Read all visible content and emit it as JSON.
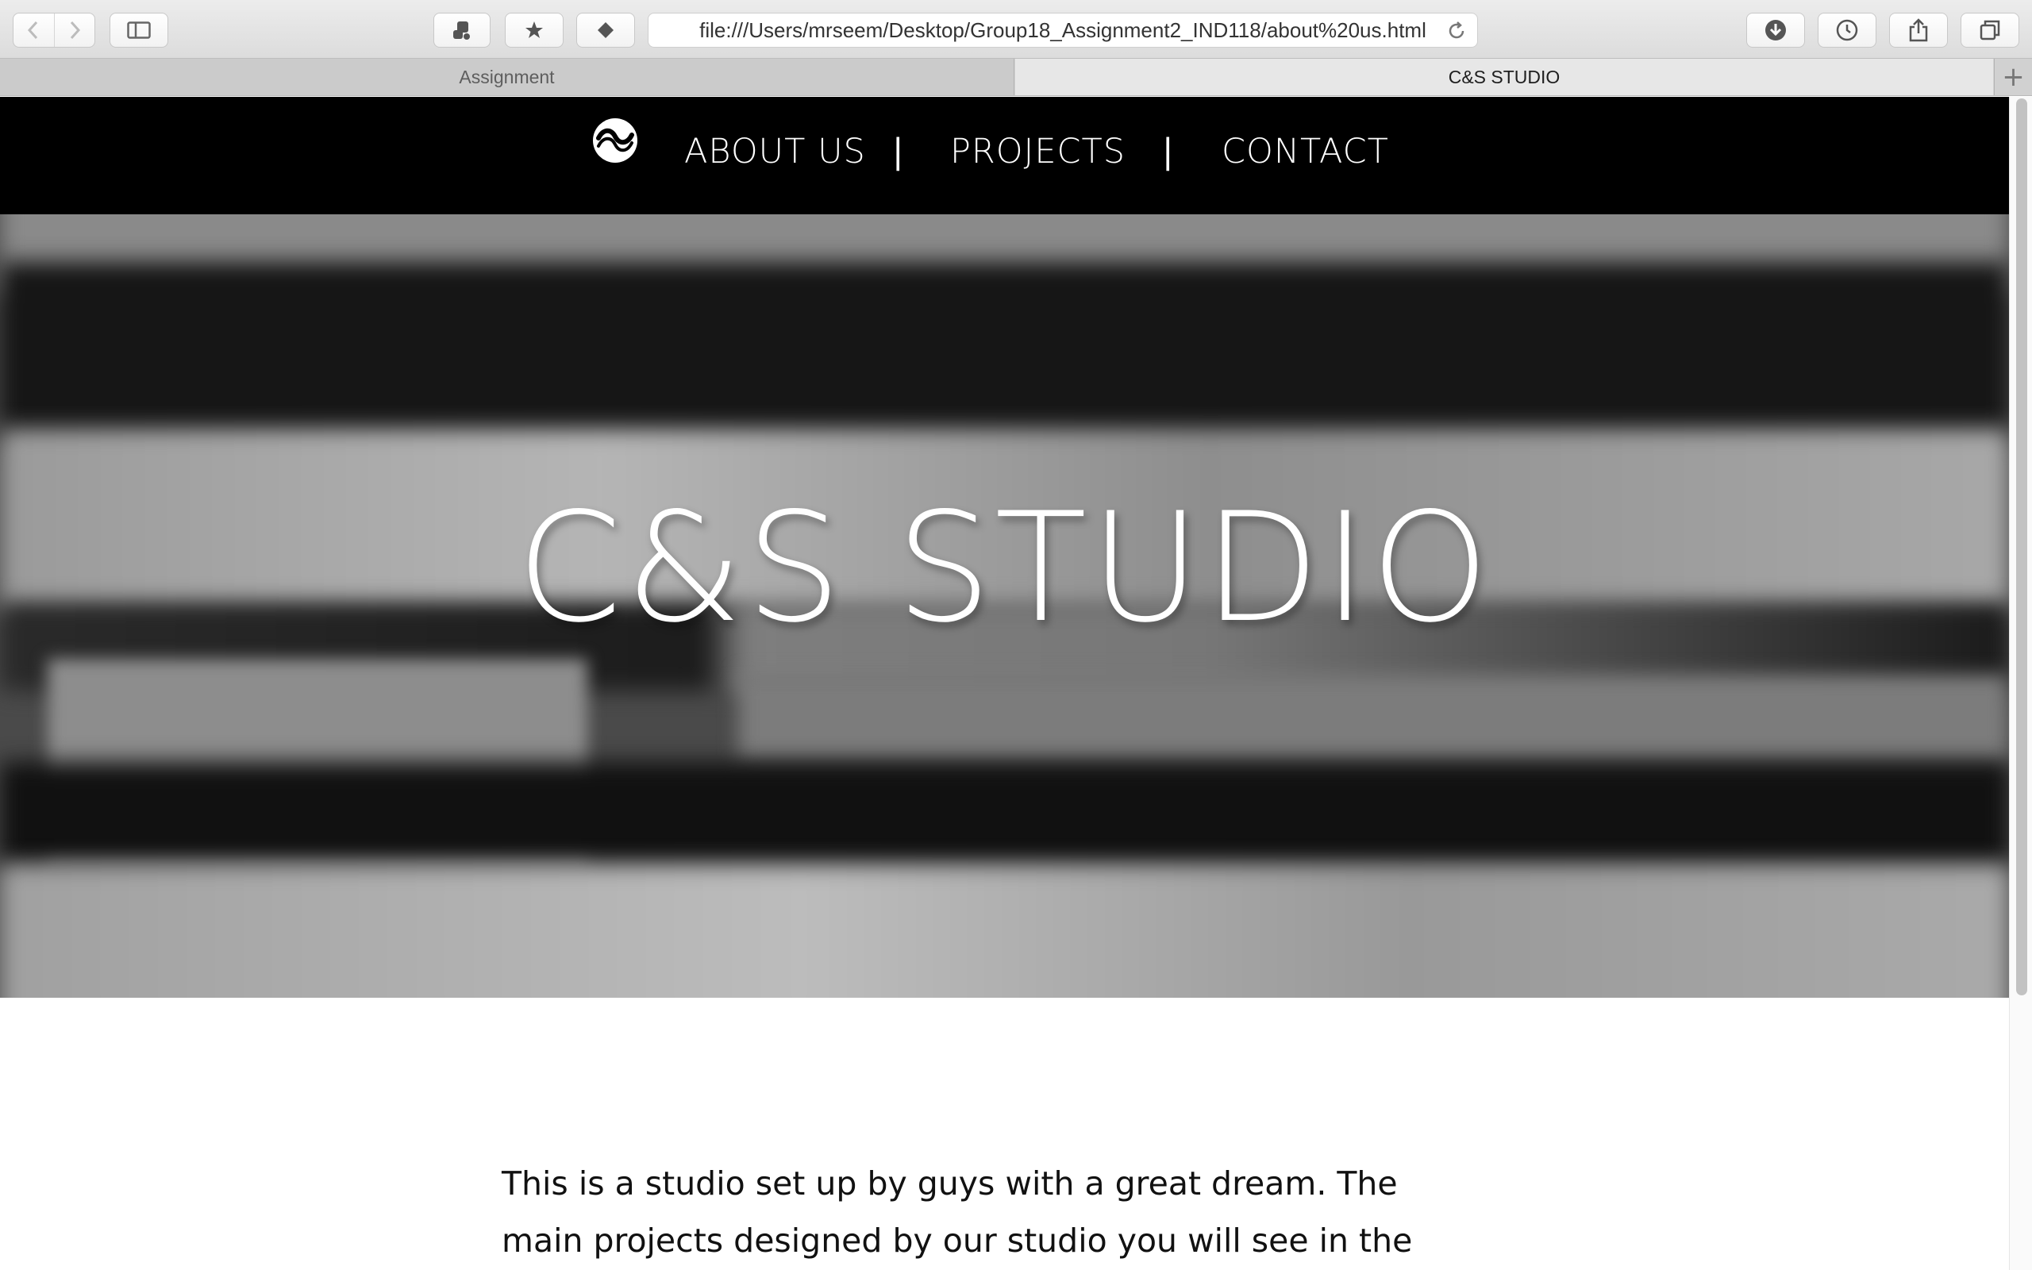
{
  "browser": {
    "url": "file:///Users/mrseem/Desktop/Group18_Assignment2_IND118/about%20us.html",
    "tabs": [
      {
        "label": "Assignment",
        "active": false
      },
      {
        "label": "C&S STUDIO",
        "active": true
      }
    ],
    "new_tab_symbol": "+"
  },
  "site": {
    "nav": {
      "items": [
        "ABOUT US",
        "PROJECTS",
        "CONTACT"
      ],
      "separator": "|"
    },
    "hero": {
      "title": "C&S STUDIO"
    },
    "intro": "This is a studio set up by guys with a great dream. The main projects designed by our studio you will see in the following"
  },
  "icons": {
    "toolbar": [
      "back-icon",
      "forward-icon",
      "sidebar-icon",
      "extension-icon",
      "bookmark-star-icon",
      "diamond-icon",
      "reload-icon",
      "download-icon",
      "history-icon",
      "share-icon",
      "tabs-overview-icon"
    ],
    "logo": "cs-studio-logo"
  },
  "colors": {
    "nav_background": "#000000",
    "nav_text": "#ffffff",
    "hero_tone": "grayscale",
    "body_text": "#111111"
  }
}
